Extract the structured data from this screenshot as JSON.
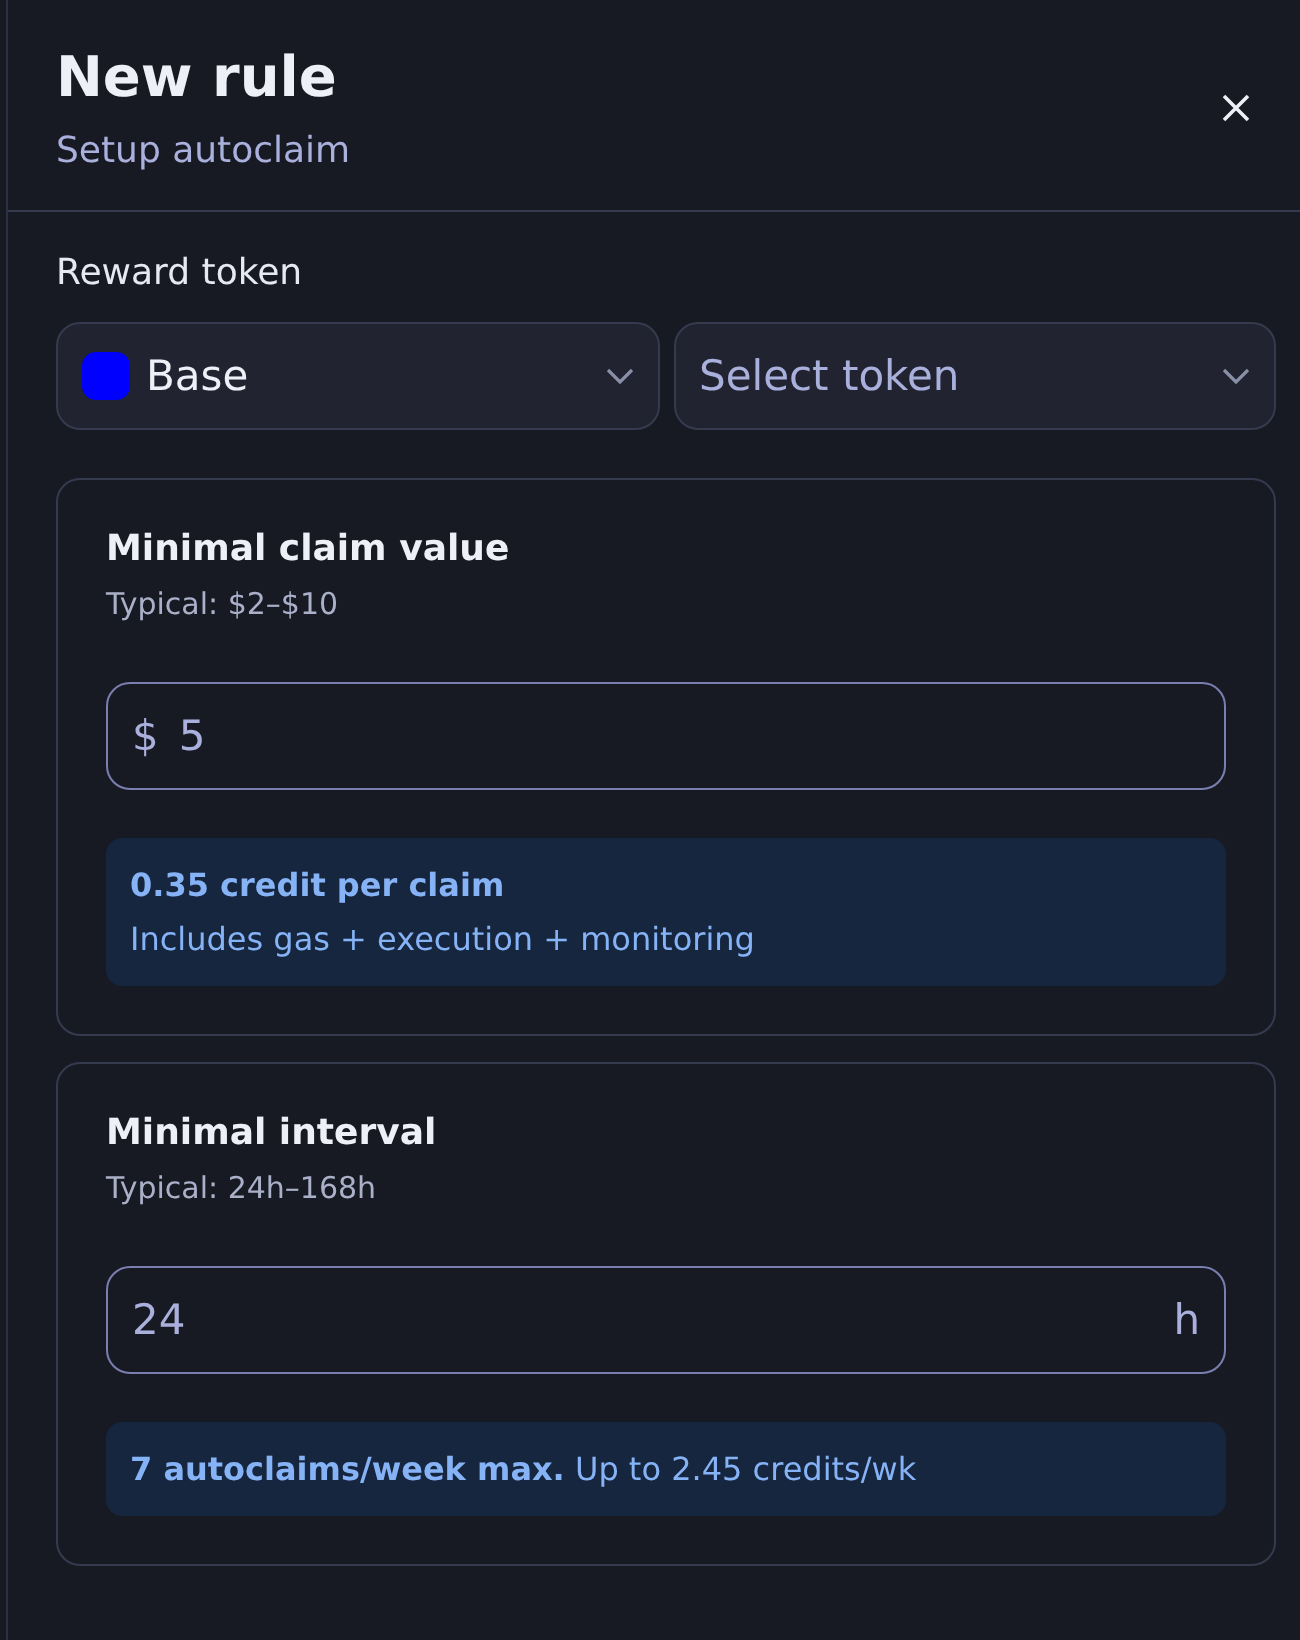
{
  "header": {
    "title": "New rule",
    "subtitle": "Setup autoclaim"
  },
  "reward_token": {
    "label": "Reward token",
    "chain": {
      "value": "Base",
      "color": "#0000ff"
    },
    "token": {
      "placeholder": "Select token"
    }
  },
  "cards": [
    {
      "title": "Minimal claim value",
      "hint": "Typical: $2–$10",
      "input": {
        "prefix": "$",
        "value": "5"
      },
      "note": {
        "title": "0.35 credit per claim",
        "text": "Includes gas + execution + monitoring"
      }
    },
    {
      "title": "Minimal interval",
      "hint": "Typical: 24h–168h",
      "input": {
        "suffix": "h",
        "value": "24"
      },
      "note": {
        "text": "**7 autoclaims/week max.** Up to 2.45 credits/wk"
      }
    }
  ]
}
